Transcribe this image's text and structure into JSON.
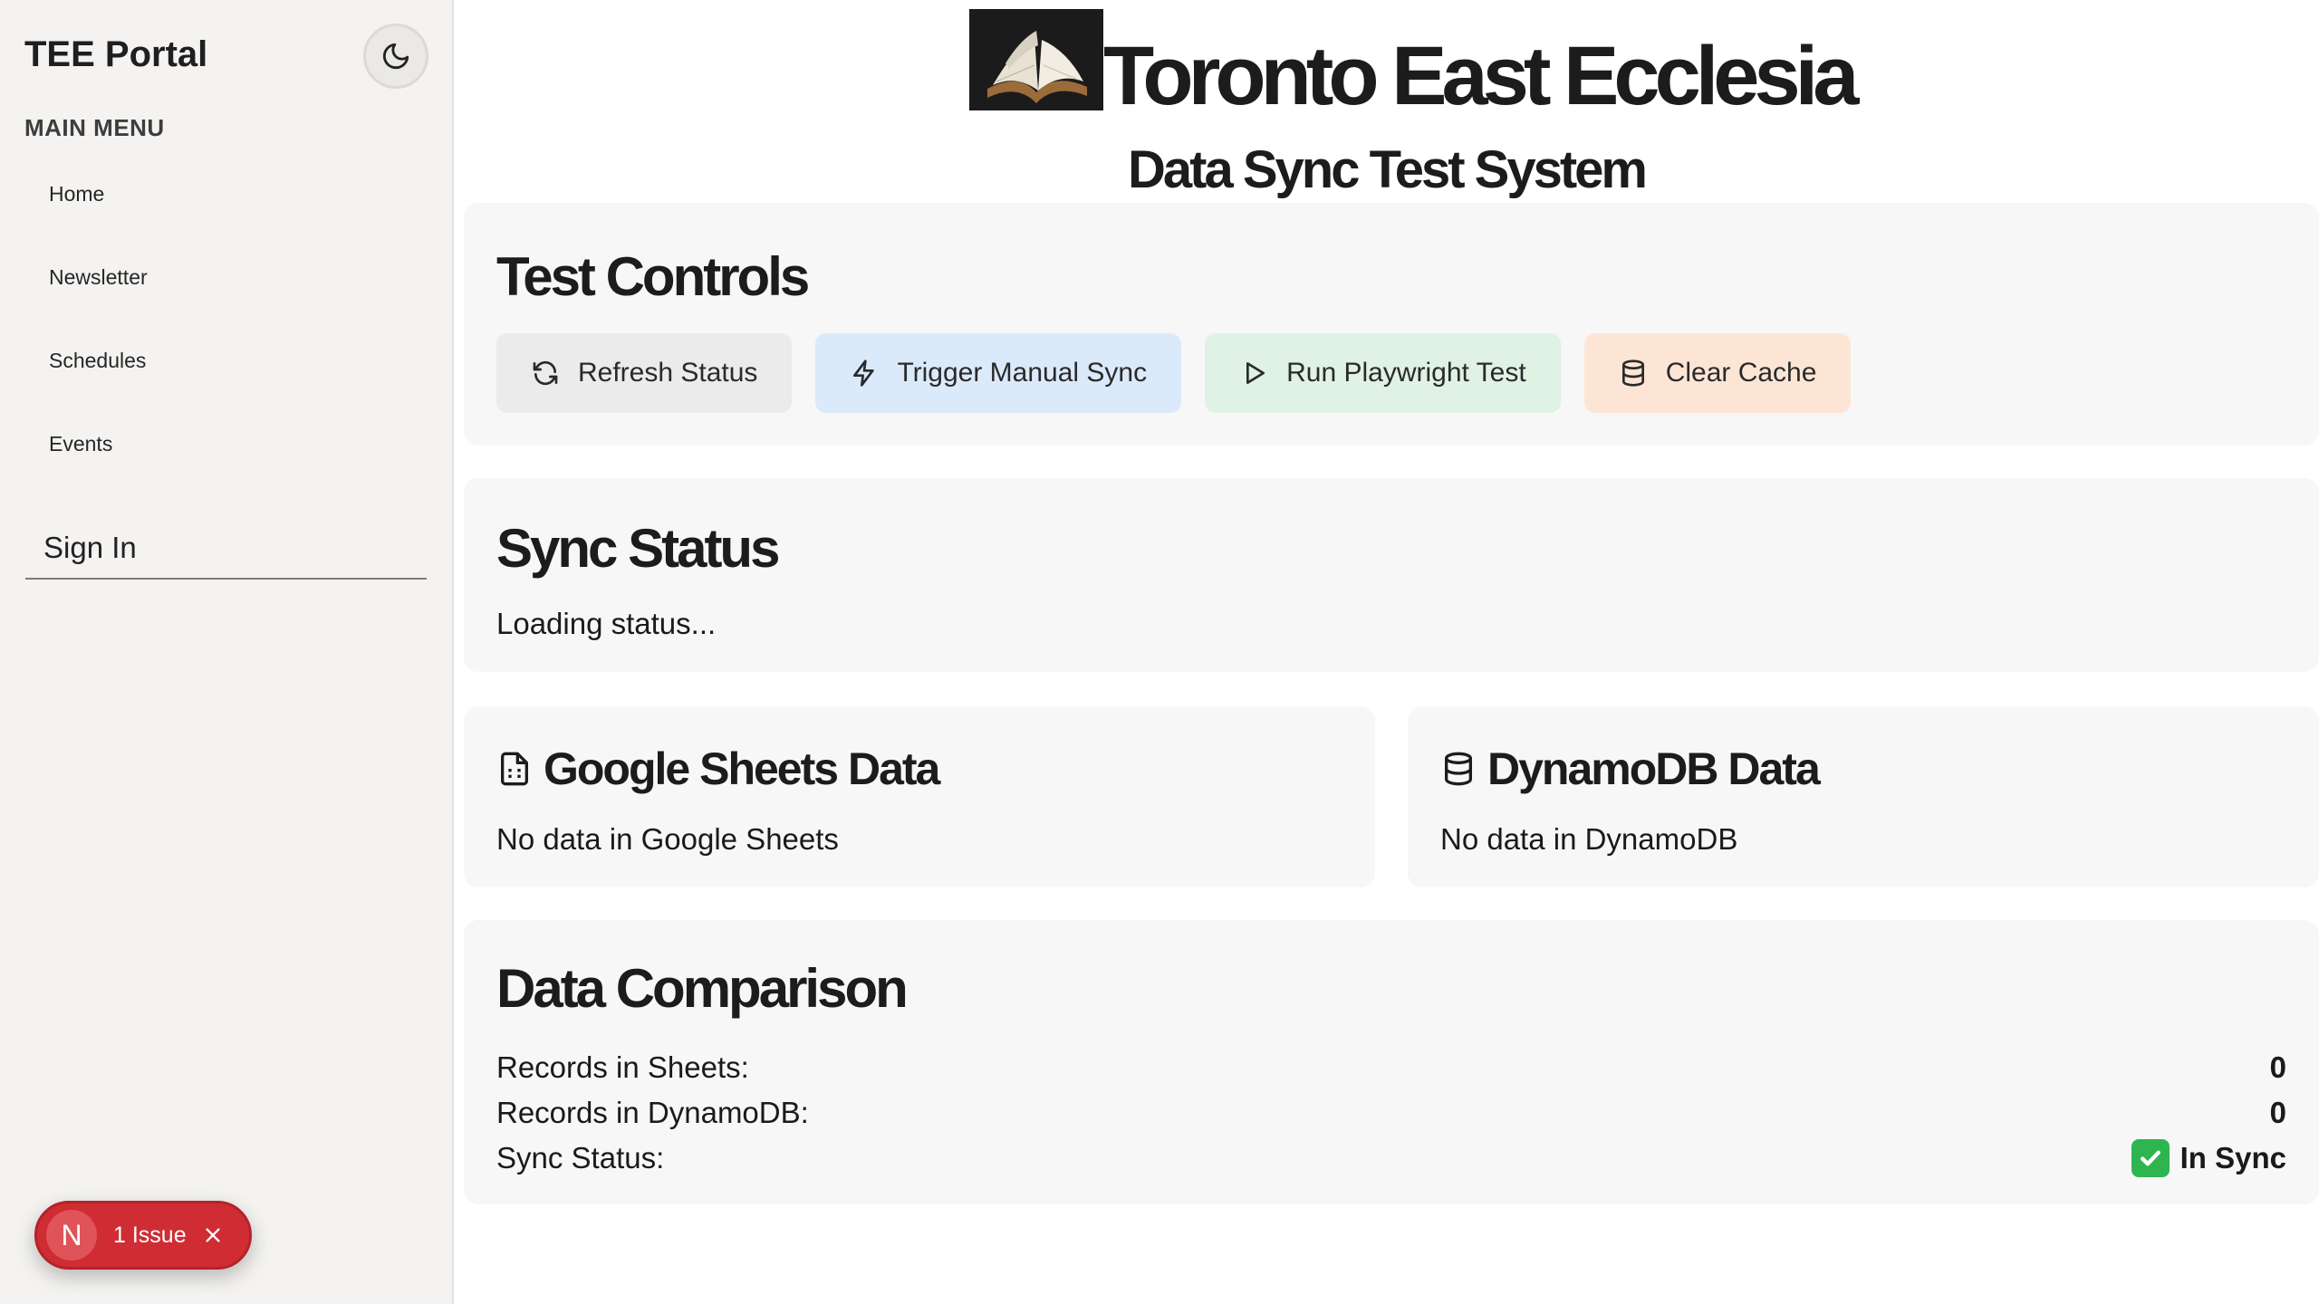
{
  "sidebar": {
    "brand": "TEE Portal",
    "menu_title": "MAIN MENU",
    "items": [
      {
        "label": "Home"
      },
      {
        "label": "Newsletter"
      },
      {
        "label": "Schedules"
      },
      {
        "label": "Events"
      }
    ],
    "signin_label": "Sign In",
    "issue_badge": {
      "initial": "N",
      "label": "1 Issue"
    }
  },
  "header": {
    "title": "Toronto East Ecclesia",
    "subtitle": "Data Sync Test System"
  },
  "controls": {
    "title": "Test Controls",
    "buttons": [
      {
        "label": "Refresh Status",
        "icon": "refresh-icon"
      },
      {
        "label": "Trigger Manual Sync",
        "icon": "lightning-icon"
      },
      {
        "label": "Run Playwright Test",
        "icon": "play-icon"
      },
      {
        "label": "Clear Cache",
        "icon": "database-icon"
      }
    ]
  },
  "sync_status": {
    "title": "Sync Status",
    "text": "Loading status..."
  },
  "sheets": {
    "title": "Google Sheets Data",
    "text": "No data in Google Sheets"
  },
  "dynamo": {
    "title": "DynamoDB Data",
    "text": "No data in DynamoDB"
  },
  "comparison": {
    "title": "Data Comparison",
    "rows": [
      {
        "label": "Records in Sheets:",
        "value": "0"
      },
      {
        "label": "Records in DynamoDB:",
        "value": "0"
      },
      {
        "label": "Sync Status:",
        "value": "In Sync"
      }
    ]
  },
  "colors": {
    "sync_button_bg": "#dbeafa",
    "test_button_bg": "#dff2e4",
    "cache_button_bg": "#fde5d6",
    "issue_red": "#cf2d33",
    "success_green": "#2eb550"
  }
}
